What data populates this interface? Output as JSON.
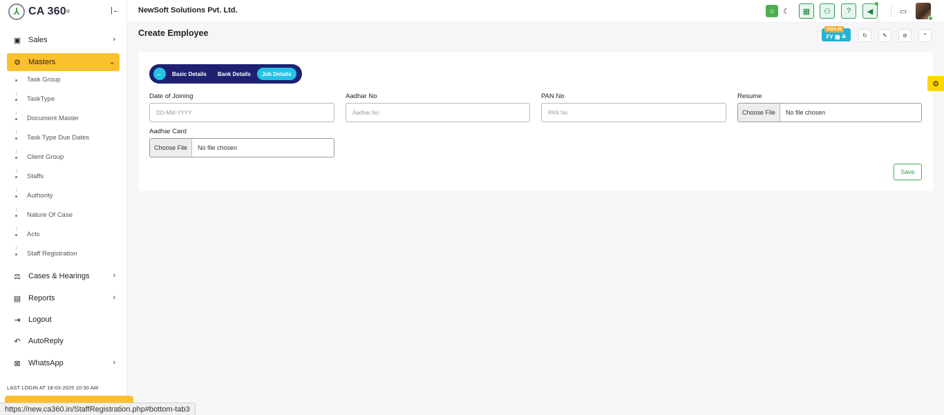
{
  "brand": {
    "name": "CA 360",
    "mark": "⅄"
  },
  "topbar": {
    "company": "NewSoft Solutions Pvt. Ltd."
  },
  "sidebar": {
    "items": [
      {
        "label": "Sales",
        "icon": "money-icon"
      },
      {
        "label": "Masters",
        "icon": "gears-icon"
      },
      {
        "label": "Cases & Hearings",
        "icon": "scales-icon"
      },
      {
        "label": "Reports",
        "icon": "file-icon"
      },
      {
        "label": "Logout",
        "icon": "logout-icon"
      },
      {
        "label": "AutoReply",
        "icon": "reply-icon"
      },
      {
        "label": "WhatsApp",
        "icon": "whatsapp-icon"
      }
    ],
    "submenu": [
      "Task Group",
      "TaskType",
      "Document Master",
      "Task Type Due Dates",
      "Client Group",
      "Staffs",
      "Authority",
      "Nature Of Case",
      "Acts",
      "Staff Registration"
    ],
    "last_login": "LAST LOGIN AT 18-03-2025 10:30 AM"
  },
  "page": {
    "title": "Create Employee",
    "fy_label": "FY",
    "fy_year": "2024-25"
  },
  "tabs": {
    "basic": "Basic Details",
    "bank": "Bank Details",
    "job": "Job Details"
  },
  "form": {
    "doj_label": "Date of Joining",
    "doj_placeholder": "DD-MM-YYYY",
    "aadhar_no_label": "Aadhar No",
    "aadhar_no_placeholder": "Aadhar No",
    "pan_label": "PAN No",
    "pan_placeholder": "PAN No",
    "resume_label": "Resume",
    "aadhar_card_label": "Aadhar Card",
    "choose_file": "Choose File",
    "no_file": "No file chosen",
    "save": "Save"
  },
  "status_url": "https://new.ca360.in/StaffRegistration.php#bottom-tab3",
  "colors": {
    "accent": "#fbc02d",
    "tab_bg": "#1e2170",
    "tab_active": "#22c3e6",
    "success": "#4caf50"
  }
}
